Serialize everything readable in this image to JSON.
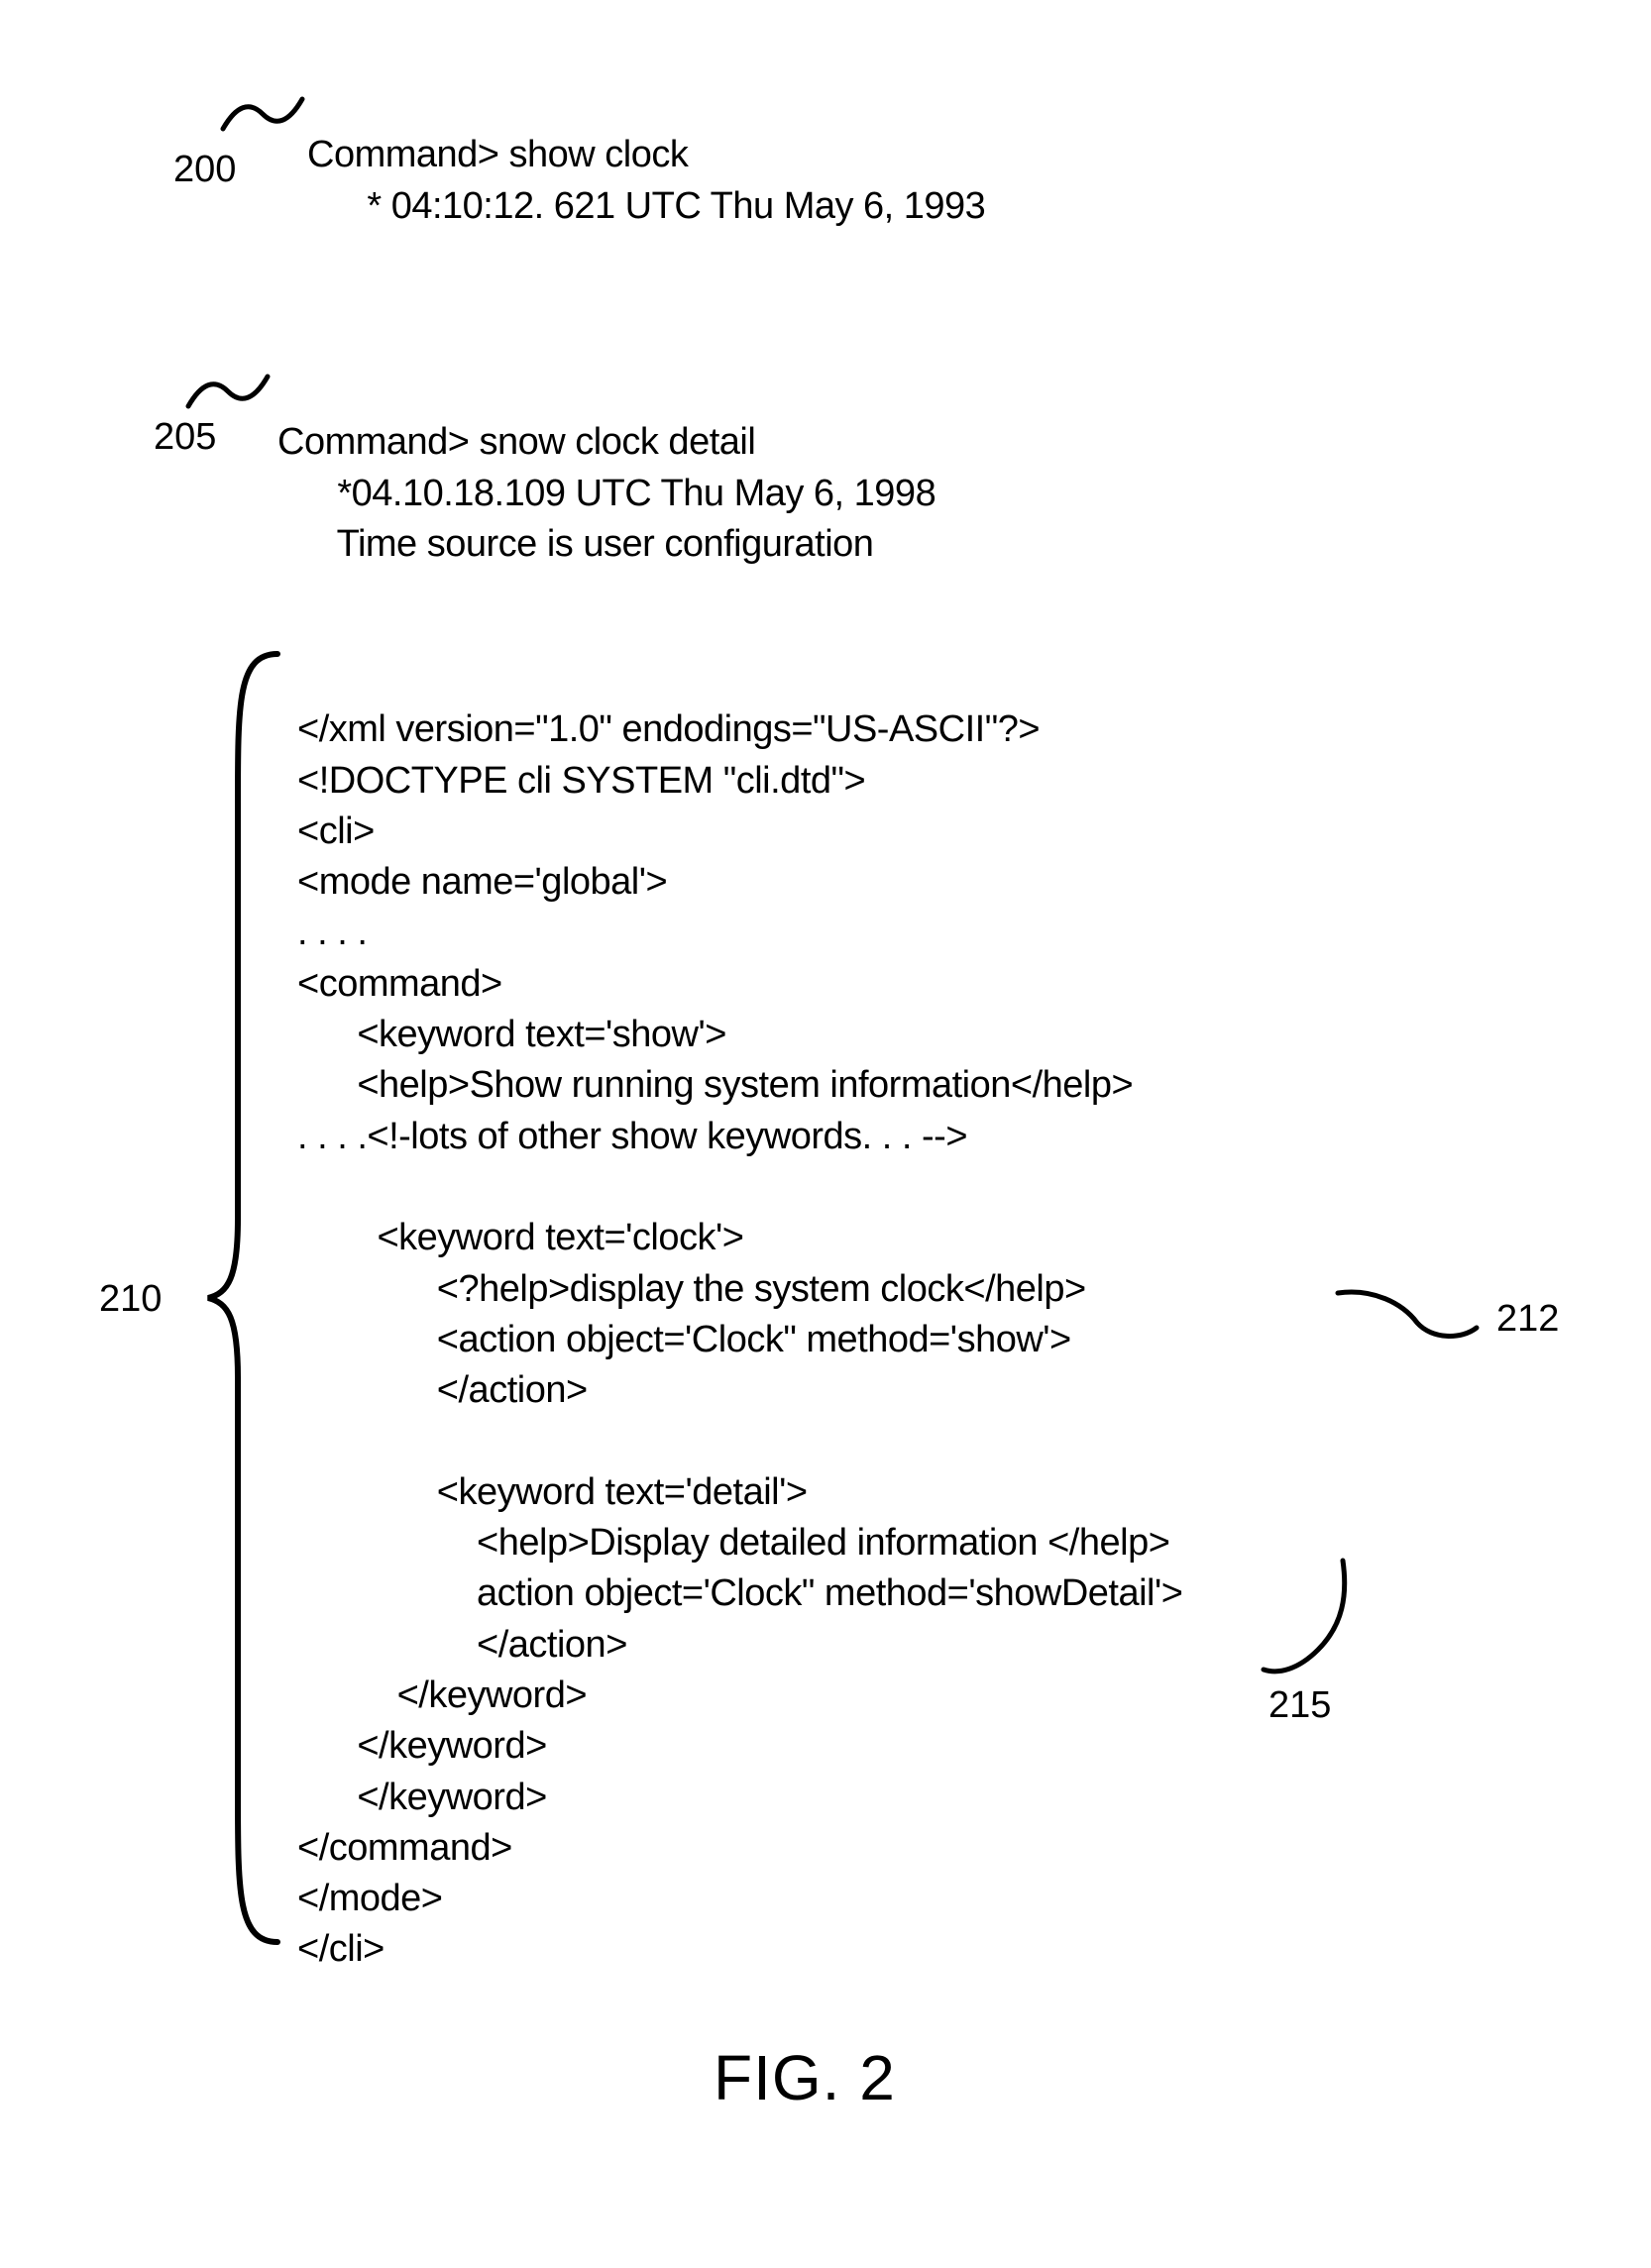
{
  "refs": {
    "r200": "200",
    "r205": "205",
    "r210": "210",
    "r212": "212",
    "r215": "215"
  },
  "block200": {
    "l1": "Command> show clock",
    "l2": "      * 04:10:12. 621 UTC Thu May 6, 1993"
  },
  "block205": {
    "l1": "Command> snow clock detail",
    "l2": "      *04.10.18.109 UTC Thu May 6, 1998",
    "l3": "      Time source is user configuration"
  },
  "xml": {
    "l01": "</xml version=\"1.0\" endodings=\"US-ASCII\"?>",
    "l02": "<!DOCTYPE cli SYSTEM \"cli.dtd\">",
    "l03": "<cli>",
    "l04": "<mode name='global'>",
    "l05": ". . . .",
    "l06": "<command>",
    "l07": "      <keyword text='show'>",
    "l08": "      <help>Show running system information</help>",
    "l09": ". . . .<!-lots of other show keywords. . . -->",
    "l10": "",
    "l11": "        <keyword text='clock'>",
    "l12": "              <?help>display the system clock</help>",
    "l13": "              <action object='Clock\" method='show'>",
    "l14": "              </action>",
    "l15": "",
    "l16": "              <keyword text='detail'>",
    "l17": "                  <help>Display detailed information </help>",
    "l18": "                  action object='Clock\" method='showDetail'>",
    "l19": "                  </action>",
    "l20": "          </keyword>",
    "l21": "      </keyword>",
    "l22": "      </keyword>",
    "l23": "</command>",
    "l24": "</mode>",
    "l25": "</cli>"
  },
  "figure_caption": "FIG. 2"
}
